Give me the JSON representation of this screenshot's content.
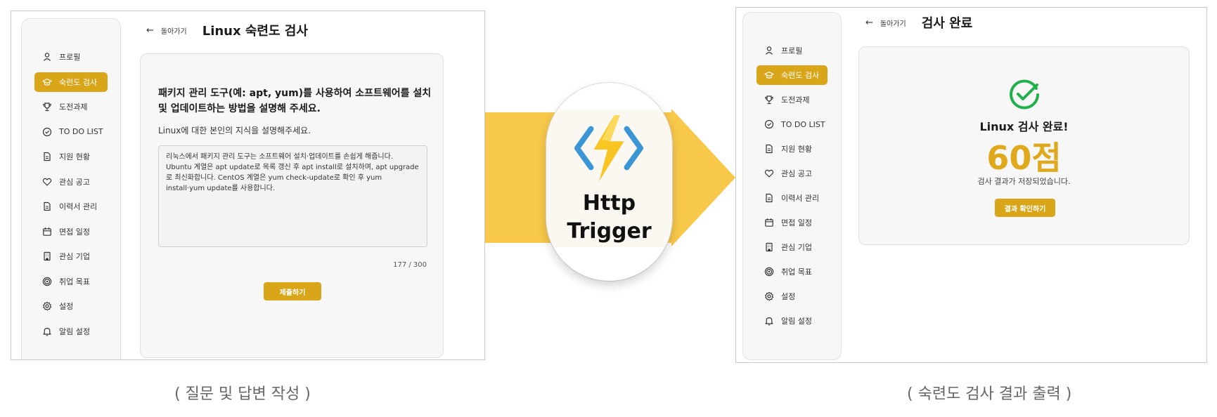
{
  "left_screen": {
    "back_label": "돌아가기",
    "title": "Linux 숙련도 검사",
    "sidebar": [
      {
        "label": "프로필",
        "icon": "user-icon",
        "active": false
      },
      {
        "label": "숙련도 검사",
        "icon": "graduation-cap-icon",
        "active": true
      },
      {
        "label": "도전과제",
        "icon": "trophy-icon",
        "active": false
      },
      {
        "label": "TO DO LIST",
        "icon": "check-circle-icon",
        "active": false
      },
      {
        "label": "지원 현황",
        "icon": "document-icon",
        "active": false
      },
      {
        "label": "관심 공고",
        "icon": "heart-icon",
        "active": false
      },
      {
        "label": "이력서 관리",
        "icon": "document-icon",
        "active": false
      },
      {
        "label": "면접 일정",
        "icon": "calendar-icon",
        "active": false
      },
      {
        "label": "관심 기업",
        "icon": "building-icon",
        "active": false
      },
      {
        "label": "취업 목표",
        "icon": "target-icon",
        "active": false
      },
      {
        "label": "설정",
        "icon": "gear-icon",
        "active": false
      },
      {
        "label": "알림 설정",
        "icon": "bell-icon",
        "active": false
      }
    ],
    "question": "패키지 관리 도구(예: apt, yum)를 사용하여 소프트웨어를 설치 및 업데이트하는 방법을 설명해 주세요.",
    "guide": "Linux에 대한 본인의 지식을 설명해주세요.",
    "answer": "리눅스에서 패키지 관리 도구는 소프트웨어 설치·업데이트를 손쉽게 해줍니다. Ubuntu 계열은 apt update로 목록 갱신 후 apt install로 설치하며, apt upgrade로 최신화합니다. CentOS 계열은 yum check-update로 확인 후 yum install·yum update를 사용합니다.",
    "counter": "177 / 300",
    "submit_label": "제출하기"
  },
  "right_screen": {
    "back_label": "돌아가기",
    "title": "검사 완료",
    "sidebar": [
      {
        "label": "프로필",
        "icon": "user-icon",
        "active": false
      },
      {
        "label": "숙련도 검사",
        "icon": "graduation-cap-icon",
        "active": true
      },
      {
        "label": "도전과제",
        "icon": "trophy-icon",
        "active": false
      },
      {
        "label": "TO DO LIST",
        "icon": "check-circle-icon",
        "active": false
      },
      {
        "label": "지원 현황",
        "icon": "document-icon",
        "active": false
      },
      {
        "label": "관심 공고",
        "icon": "heart-icon",
        "active": false
      },
      {
        "label": "이력서 관리",
        "icon": "document-icon",
        "active": false
      },
      {
        "label": "면접 일정",
        "icon": "calendar-icon",
        "active": false
      },
      {
        "label": "관심 기업",
        "icon": "building-icon",
        "active": false
      },
      {
        "label": "취업 목표",
        "icon": "target-icon",
        "active": false
      },
      {
        "label": "설정",
        "icon": "gear-icon",
        "active": false
      },
      {
        "label": "알림 설정",
        "icon": "bell-icon",
        "active": false
      }
    ],
    "done_title": "Linux 검사 완료!",
    "score": "60점",
    "saved_text": "검사 결과가 저장되었습니다.",
    "result_button": "결과 확인하기"
  },
  "trigger": {
    "label_line1": "Http",
    "label_line2": "Trigger",
    "icon": "azure-functions-lightning-icon"
  },
  "captions": {
    "left": "( 질문 및 답변 작성 )",
    "right": "( 숙련도 검사 결과 출력 )"
  },
  "colors": {
    "accent": "#d9a61a",
    "arrow": "#f8c84a",
    "success": "#22b04b",
    "score": "#e0a91b"
  }
}
